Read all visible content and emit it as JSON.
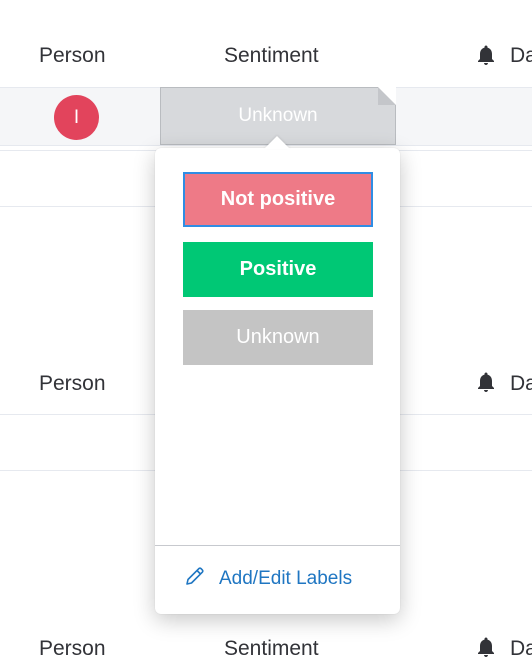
{
  "columns": {
    "person": "Person",
    "sentiment": "Sentiment",
    "date_partial": "Da"
  },
  "rows": [
    {
      "avatar_initial": "I",
      "avatar_color": "#e2445c",
      "sentiment_value": "Unknown"
    }
  ],
  "status_picker": {
    "labels": [
      {
        "text": "Not positive",
        "color": "#ee7a87",
        "selected": true
      },
      {
        "text": "Positive",
        "color": "#00c875"
      },
      {
        "text": "Unknown",
        "color": "#c4c4c4"
      }
    ],
    "edit_labels": "Add/Edit Labels",
    "edit_icon": "pencil-icon"
  },
  "icons": {
    "column_icon": "bell-icon"
  }
}
